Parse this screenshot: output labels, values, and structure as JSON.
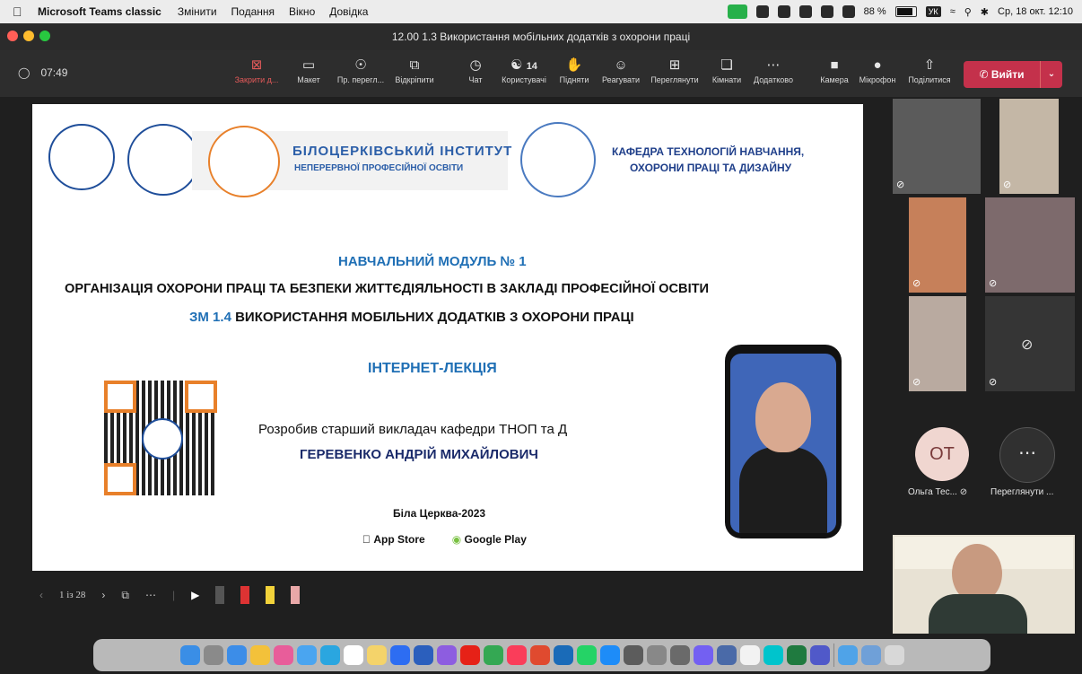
{
  "menubar": {
    "app_name": "Microsoft Teams classic",
    "items": [
      "Змінити",
      "Подання",
      "Вікно",
      "Довідка"
    ],
    "battery": "88 %",
    "lang": "УК",
    "datetime": "Ср, 18 окт.  12:10"
  },
  "window": {
    "title": "12.00 1.3 Використання мобільних додатків з охорони праці"
  },
  "meeting": {
    "timer": "07:49",
    "tools": [
      {
        "label": "Закрити д...",
        "icon": "close-share-icon",
        "red": true
      },
      {
        "label": "Макет",
        "icon": "layout-icon"
      },
      {
        "label": "Пр. перегл...",
        "icon": "eye-icon"
      },
      {
        "label": "Відкріпити",
        "icon": "popout-icon"
      },
      {
        "label": "Чат",
        "icon": "chat-icon"
      },
      {
        "label": "Користувачі",
        "icon": "people-icon",
        "count": "14"
      },
      {
        "label": "Підняти",
        "icon": "hand-icon"
      },
      {
        "label": "Реагувати",
        "icon": "smile-icon"
      },
      {
        "label": "Переглянути",
        "icon": "grid-icon"
      },
      {
        "label": "Кімнати",
        "icon": "rooms-icon"
      },
      {
        "label": "Додатково",
        "icon": "more-icon"
      },
      {
        "label": "Камера",
        "icon": "camera-icon"
      },
      {
        "label": "Мікрофон",
        "icon": "mic-icon"
      },
      {
        "label": "Поділитися",
        "icon": "share-icon"
      }
    ],
    "leave_label": "Вийти"
  },
  "slide": {
    "institute_line1": "БІЛОЦЕРКІВСЬКИЙ ІНСТИТУТ",
    "institute_line2": "НЕПЕРЕРВНОЇ ПРОФЕСІЙНОЇ ОСВІТИ",
    "dept_line1": "КАФЕДРА ТЕХНОЛОГІЙ НАВЧАННЯ,",
    "dept_line2": "ОХОРОНИ ПРАЦІ ТА ДИЗАЙНУ",
    "module": "НАВЧАЛЬНИЙ МОДУЛЬ № 1",
    "topic": "ОРГАНІЗАЦІЯ ОХОРОНИ ПРАЦІ ТА БЕЗПЕКИ ЖИТТЄДІЯЛЬНОСТІ В ЗАКЛАДІ ПРОФЕСІЙНОЇ ОСВІТИ",
    "sub_prefix": "ЗМ 1.4",
    "sub_rest": " ВИКОРИСТАННЯ МОБІЛЬНИХ ДОДАТКІВ З ОХОРОНИ ПРАЦІ",
    "type": "ІНТЕРНЕТ-ЛЕКЦІЯ",
    "author_role": "Розробив старший викладач кафедри ТНОП та Д",
    "author_name": "ГЕРЕВЕНКО АНДРІЙ МИХАЙЛОВИЧ",
    "place_year": "Біла Церква-2023",
    "store1": "App Store",
    "store2": "Google Play"
  },
  "slide_controls": {
    "page": "1 із 28"
  },
  "participants": {
    "avatar_initials": "ОТ",
    "avatar_name": "Ольга Тес...",
    "more_label": "Переглянути ..."
  },
  "colors": {
    "accent": "#1f6fb5",
    "leave": "#c4314b",
    "qr_orange": "#e8802a"
  }
}
